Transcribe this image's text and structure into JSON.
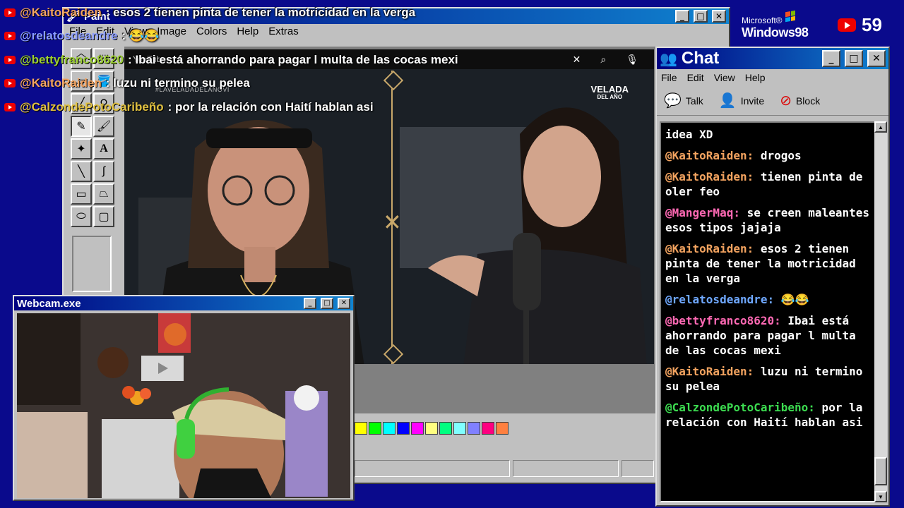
{
  "paint": {
    "title": "Paint",
    "menu": [
      "File",
      "Edit",
      "View",
      "Image",
      "Colors",
      "Help",
      "Extras"
    ],
    "palette": [
      "#ffff00",
      "#00ff00",
      "#00ffff",
      "#0000ff",
      "#ff00ff",
      "#ffff80",
      "#00ff80",
      "#80ffff",
      "#8080ff",
      "#ff0080",
      "#ff8040"
    ]
  },
  "video": {
    "top_label": "YouTube",
    "hashtag": "#LAVELADADELANOVI",
    "brand_line1": "VELADA",
    "brand_line2": "DEL AÑO"
  },
  "ticker": [
    {
      "user": "@KaitoRaiden",
      "color": "#f4a460",
      "msg": ": esos 2 tienen pinta de tener la motricidad en la verga"
    },
    {
      "user": "@relatosdeandre",
      "color": "#8a9cff",
      "msg": ": 😂😂"
    },
    {
      "user": "@bettyfranco8620",
      "color": "#9acd32",
      "msg": ": Ibai está ahorrando para pagar l multa de las cocas mexi"
    },
    {
      "user": "@KaitoRaiden",
      "color": "#f4a460",
      "msg": ": luzu ni termino su pelea"
    },
    {
      "user": "@CalzondePotoCaribeño",
      "color": "#e0c040",
      "msg": ": por la relación con Haití hablan asi"
    }
  ],
  "os": {
    "microsoft": "Microsoft®",
    "windows": "Windows98"
  },
  "viewers": "59",
  "chat": {
    "title": "Chat",
    "menu": [
      "File",
      "Edit",
      "View",
      "Help"
    ],
    "tools": [
      {
        "label": "Talk",
        "icon": "talk-icon"
      },
      {
        "label": "Invite",
        "icon": "invite-icon"
      },
      {
        "label": "Block",
        "icon": "block-icon"
      }
    ],
    "messages": [
      {
        "user": "",
        "color": "#ffffff",
        "text": "idea XD"
      },
      {
        "user": "@KaitoRaiden:",
        "color": "#f4a460",
        "text": " drogos"
      },
      {
        "user": "@KaitoRaiden:",
        "color": "#f4a460",
        "text": " tienen pinta de oler feo"
      },
      {
        "user": "@MangerMaq:",
        "color": "#ff69b4",
        "text": " se creen maleantes esos tipos jajaja"
      },
      {
        "user": "@KaitoRaiden:",
        "color": "#f4a460",
        "text": " esos 2 tienen pinta de tener la motricidad en la verga"
      },
      {
        "user": "@relatosdeandre:",
        "color": "#6fa8ff",
        "text": " 😂😂"
      },
      {
        "user": "@bettyfranco8620:",
        "color": "#ff69b4",
        "text": " Ibai está ahorrando para pagar l multa de las cocas mexi"
      },
      {
        "user": "@KaitoRaiden:",
        "color": "#f4a460",
        "text": " luzu ni termino su pelea"
      },
      {
        "user": "@CalzondePotoCaribeño:",
        "color": "#3cdc50",
        "text": " por la relación con Haití hablan asi"
      }
    ]
  },
  "webcam": {
    "title": "Webcam.exe"
  }
}
